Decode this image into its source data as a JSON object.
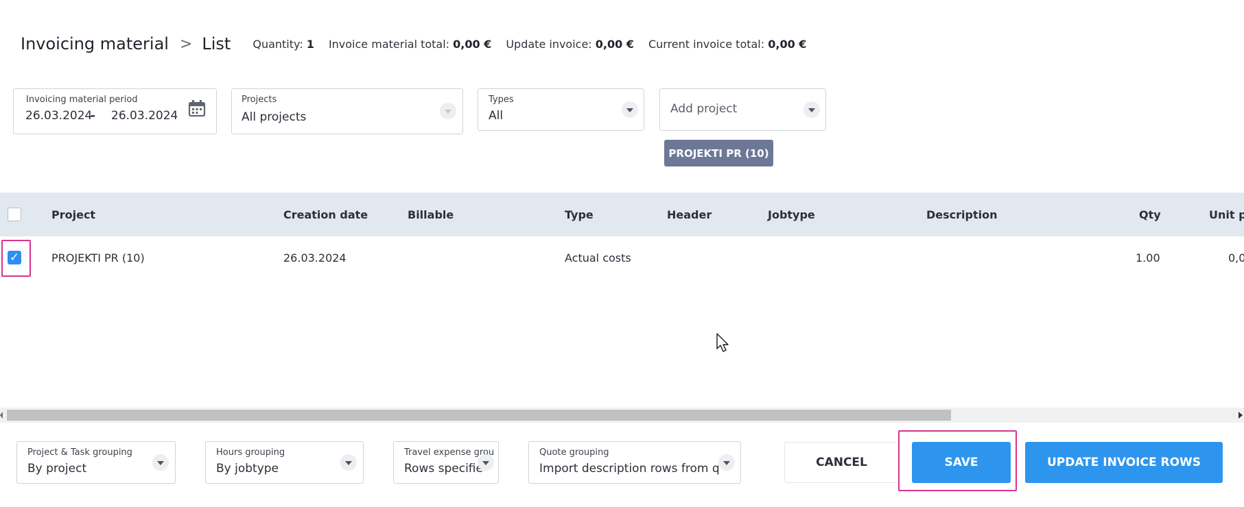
{
  "header": {
    "title": "Invoicing material",
    "separator": ">",
    "subtitle": "List",
    "stats": [
      {
        "label": "Quantity: ",
        "value": "1"
      },
      {
        "label": "Invoice material total: ",
        "value": "0,00 €"
      },
      {
        "label": "Update invoice: ",
        "value": "0,00 €"
      },
      {
        "label": "Current invoice total: ",
        "value": "0,00 €"
      }
    ]
  },
  "filters": {
    "period": {
      "label": "Invoicing material period",
      "from": "26.03.2024",
      "dash": "-",
      "to": "26.03.2024",
      "icon": "calendar-icon"
    },
    "projects": {
      "label": "Projects",
      "value": "All projects"
    },
    "types": {
      "label": "Types",
      "value": "All"
    },
    "add_project": {
      "placeholder": "Add project"
    },
    "chip": "PROJEKTI PR (10)"
  },
  "table": {
    "columns": [
      "Project",
      "Creation date",
      "Billable",
      "Type",
      "Header",
      "Jobtype",
      "Description",
      "Qty",
      "Unit pr"
    ],
    "rows": [
      {
        "checked": true,
        "project": "PROJEKTI PR (10)",
        "creation_date": "26.03.2024",
        "billable": "",
        "type": "Actual costs",
        "header": "",
        "jobtype": "",
        "description": "",
        "qty": "1.00",
        "unit_price": "0,0"
      }
    ]
  },
  "footer": {
    "groupings": [
      {
        "label": "Project & Task grouping",
        "value": "By project"
      },
      {
        "label": "Hours grouping",
        "value": "By jobtype"
      },
      {
        "label": "Travel expense grou...",
        "value": "Rows specified"
      },
      {
        "label": "Quote grouping",
        "value": "Import description rows from qu..."
      }
    ],
    "cancel_label": "CANCEL",
    "save_label": "SAVE",
    "update_label": "UPDATE INVOICE ROWS"
  },
  "colors": {
    "primary": "#2d95ee",
    "chip": "#6c7896",
    "highlight": "#d6338f",
    "table_header": "#e1e8f0"
  }
}
